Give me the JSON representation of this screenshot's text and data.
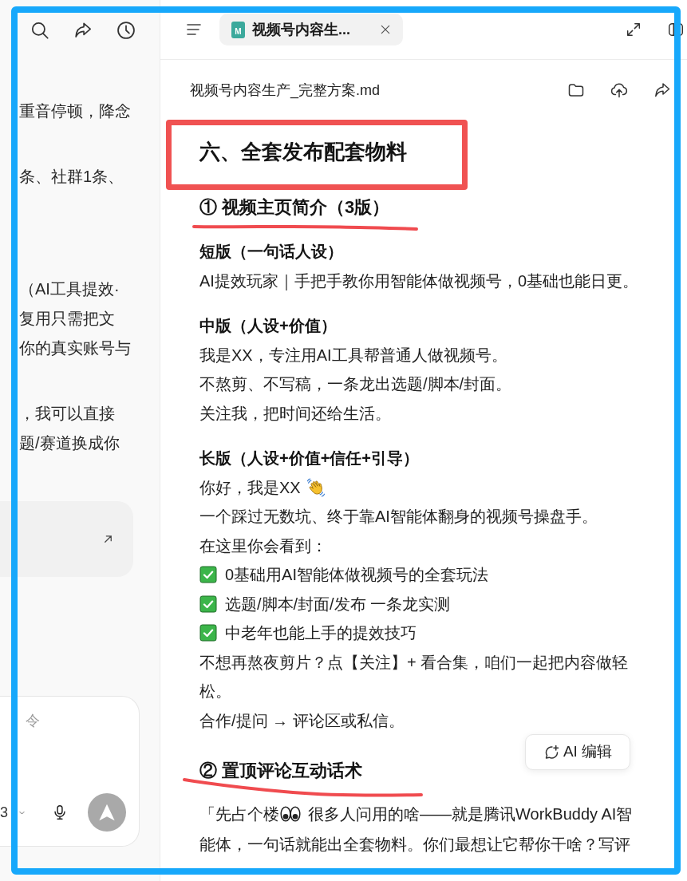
{
  "highlight_frame": true,
  "sidebar": {
    "messages": [
      {
        "lines": [
          "重音停顿，降念"
        ]
      },
      {
        "lines": [
          "条、社群1条、"
        ]
      },
      {
        "lines": [
          "（AI工具提效·",
          "复用只需把文",
          "你的真实账号与"
        ]
      },
      {
        "lines": [
          "，我可以直接",
          "题/赛道换成你"
        ]
      }
    ],
    "composer": {
      "placeholder": "令",
      "model": "3"
    }
  },
  "tabs": [
    {
      "badge": "M",
      "label": "视频号内容生...",
      "selected": true
    }
  ],
  "document": {
    "filename": "视频号内容生产_完整方案.md",
    "blocks": [
      {
        "kind": "title",
        "text": "六、全套发布配套物料",
        "boxed": true
      },
      {
        "kind": "subtitle",
        "text": "① 视频主页简介（3版）",
        "underlined": true
      },
      {
        "kind": "section",
        "title": "短版（一句话人设）",
        "lines": [
          {
            "kind": "plain",
            "text": "AI提效玩家｜手把手教你用智能体做视频号，0基础也能日更。"
          }
        ]
      },
      {
        "kind": "section",
        "title": "中版（人设+价值）",
        "lines": [
          {
            "kind": "plain",
            "text": "我是XX，专注用AI工具帮普通人做视频号。"
          },
          {
            "kind": "plain",
            "text": "不熬剪、不写稿，一条龙出选题/脚本/封面。"
          },
          {
            "kind": "plain",
            "text": "关注我，把时间还给生活。"
          }
        ]
      },
      {
        "kind": "section",
        "title": "长版（人设+价值+信任+引导）",
        "lines": [
          {
            "kind": "greeting",
            "text": "你好，我是XX"
          },
          {
            "kind": "plain",
            "text": "一个踩过无数坑、终于靠AI智能体翻身的视频号操盘手。"
          },
          {
            "kind": "plain",
            "text": "在这里你会看到："
          },
          {
            "kind": "check",
            "text": "0基础用AI智能体做视频号的全套玩法"
          },
          {
            "kind": "check",
            "text": "选题/脚本/封面/发布 一条龙实测"
          },
          {
            "kind": "check",
            "text": "中老年也能上手的提效技巧"
          },
          {
            "kind": "plain",
            "text": "不想再熬夜剪片？点【关注】+ 看合集，咱们一起把内容做轻松。"
          },
          {
            "kind": "plain",
            "text": "合作/提问 → 评论区或私信。"
          }
        ]
      },
      {
        "kind": "subtitle",
        "text": "② 置顶评论互动话术",
        "underlined": true
      },
      {
        "kind": "comment",
        "lines": [
          {
            "kind": "emoji",
            "before": "「先占个楼",
            "after": "很多人问用的啥——就是腾讯WorkBuddy AI智"
          },
          {
            "kind": "plain",
            "text": "能体，一句话就能出全套物料。你们最想让它帮你干啥？写评"
          }
        ]
      }
    ]
  },
  "ai_edit": {
    "label": "AI 编辑"
  }
}
